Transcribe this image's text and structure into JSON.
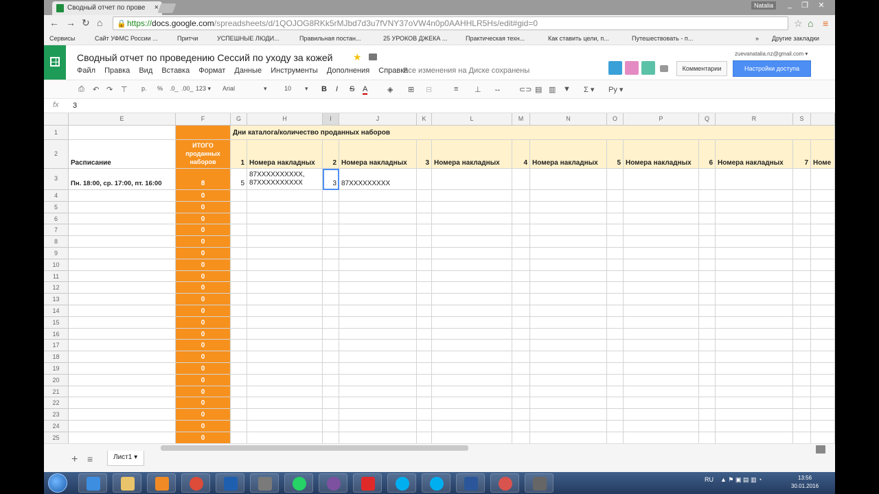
{
  "browser": {
    "tab_title": "Сводный отчет по прове",
    "tab_close": "×",
    "user": "Natalia",
    "win_buttons": [
      "_",
      "❐",
      "✕"
    ],
    "url_scheme": "https://",
    "url_host": "docs.google.com",
    "url_path": "/spreadsheets/d/1QOJOG8RKk5rMJbd7d3u7fVNY37oVW4n0p0AAHHLR5Hs/edit#gid=0",
    "bookmarks": [
      "Сервисы",
      "Сайт УФМС России ...",
      "Притчи",
      "УСПЕШНЫЕ ЛЮДИ...",
      "Правильная постан...",
      "25 УРОКОВ ДЖЕКА ...",
      "Практическая техн...",
      "Как ставить цели, п...",
      "Путешествовать - п..."
    ],
    "bookmarks_more": "»",
    "other_bookmarks": "Другие закладки"
  },
  "doc": {
    "title": "Сводный отчет по проведению Сессий по уходу за кожей",
    "menu": [
      "Файл",
      "Правка",
      "Вид",
      "Вставка",
      "Формат",
      "Данные",
      "Инструменты",
      "Дополнения",
      "Справка"
    ],
    "saved_status": "Все изменения на Диске сохранены",
    "account_email": "zuevanatalia.nz@gmail.com ▾",
    "comments_label": "Комментарии",
    "share_label": "Настройки доступа"
  },
  "toolbar": {
    "currency": "р.",
    "percent": "%",
    "decimal_less": ".0_",
    "decimal_more": ".00_",
    "number_format": "123 ▾",
    "font": "Arial",
    "font_size": "10",
    "bold": "B",
    "italic": "I",
    "strike": "S",
    "text_color": "A",
    "sigma": "Σ ▾",
    "input_tools": "Ру ▾"
  },
  "formula": {
    "fx": "fx",
    "value": "3"
  },
  "grid": {
    "col_headers": [
      "E",
      "F",
      "G",
      "H",
      "I",
      "J",
      "K",
      "L",
      "M",
      "N",
      "O",
      "P",
      "Q",
      "R",
      "S"
    ],
    "row1_header": "Дни каталога/количество проданных наборов",
    "row2": {
      "schedule_label": "Расписание",
      "total_label": "ИТОГО проданных наборов",
      "groups": [
        {
          "day": "1",
          "label": "Номера накладных"
        },
        {
          "day": "2",
          "label": "Номера накладных"
        },
        {
          "day": "3",
          "label": "Номера накладных"
        },
        {
          "day": "4",
          "label": "Номера накладных"
        },
        {
          "day": "5",
          "label": "Номера накладных"
        },
        {
          "day": "6",
          "label": "Номера накладных"
        },
        {
          "day": "7",
          "label": "Номе"
        }
      ]
    },
    "row3": {
      "schedule": "Пн. 18:00, ср. 17:00, пт. 16:00",
      "total": "8",
      "g_value": "5",
      "h_line1": "87XXXXXXXXXX,",
      "h_line2": "87XXXXXXXXXX",
      "i_value": "3",
      "j_value": "87XXXXXXXXX"
    },
    "row_numbers": [
      "1",
      "2",
      "3",
      "4",
      "5",
      "6",
      "7",
      "8",
      "9",
      "10",
      "11",
      "12",
      "13",
      "14",
      "15",
      "16",
      "17",
      "18",
      "19",
      "20",
      "21",
      "22",
      "23",
      "24",
      "25"
    ],
    "empty_totals": [
      "0",
      "0",
      "0",
      "0",
      "0",
      "0",
      "0",
      "0",
      "0",
      "0",
      "0",
      "0",
      "0",
      "0",
      "0",
      "0",
      "0",
      "0",
      "0",
      "0",
      "0",
      "0"
    ]
  },
  "sheets": {
    "add": "+",
    "list": "≡",
    "active": "Лист1 ▾"
  },
  "taskbar": {
    "lang": "RU",
    "time": "13:56",
    "date": "30.01.2016",
    "apps": [
      "internet-explorer",
      "file-explorer",
      "media-player",
      "chrome",
      "outlook",
      "calculator",
      "whatsapp",
      "viber",
      "yandex",
      "skype",
      "skype-2",
      "word",
      "paint",
      "screen-recorder"
    ]
  },
  "colors": {
    "orange": "#f6911e",
    "yellow": "#fff2cc",
    "sheets_green": "#1f9b58",
    "share_blue": "#4d8ef4"
  }
}
